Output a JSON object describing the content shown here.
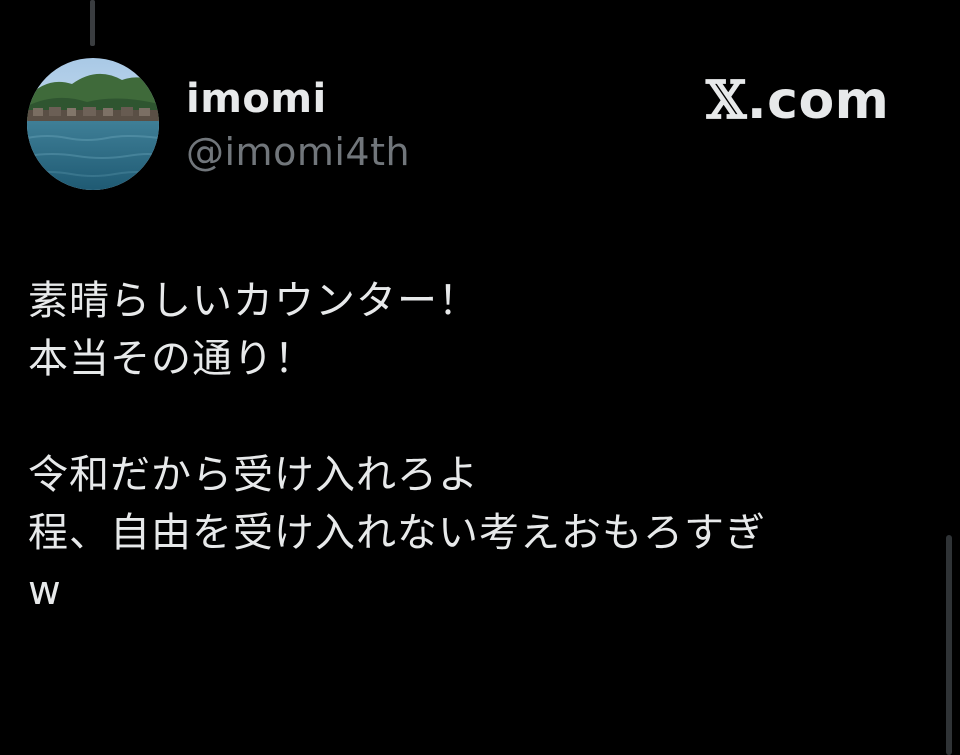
{
  "post": {
    "author": {
      "display_name": "imomi",
      "handle": "@imomi4th",
      "avatar_icon": "avatar-photo-waterfront-village"
    },
    "brand": {
      "mark": "𝕏",
      "suffix": ".com"
    },
    "paragraphs": [
      [
        "素晴らしいカウンター！",
        "本当その通り！"
      ],
      [
        "令和だから受け入れろよ",
        "程、自由を受け入れない考えおもろすぎ",
        "w"
      ]
    ]
  },
  "colors": {
    "background": "#000000",
    "primary_text": "#e7e9ea",
    "secondary_text": "#71767b"
  }
}
